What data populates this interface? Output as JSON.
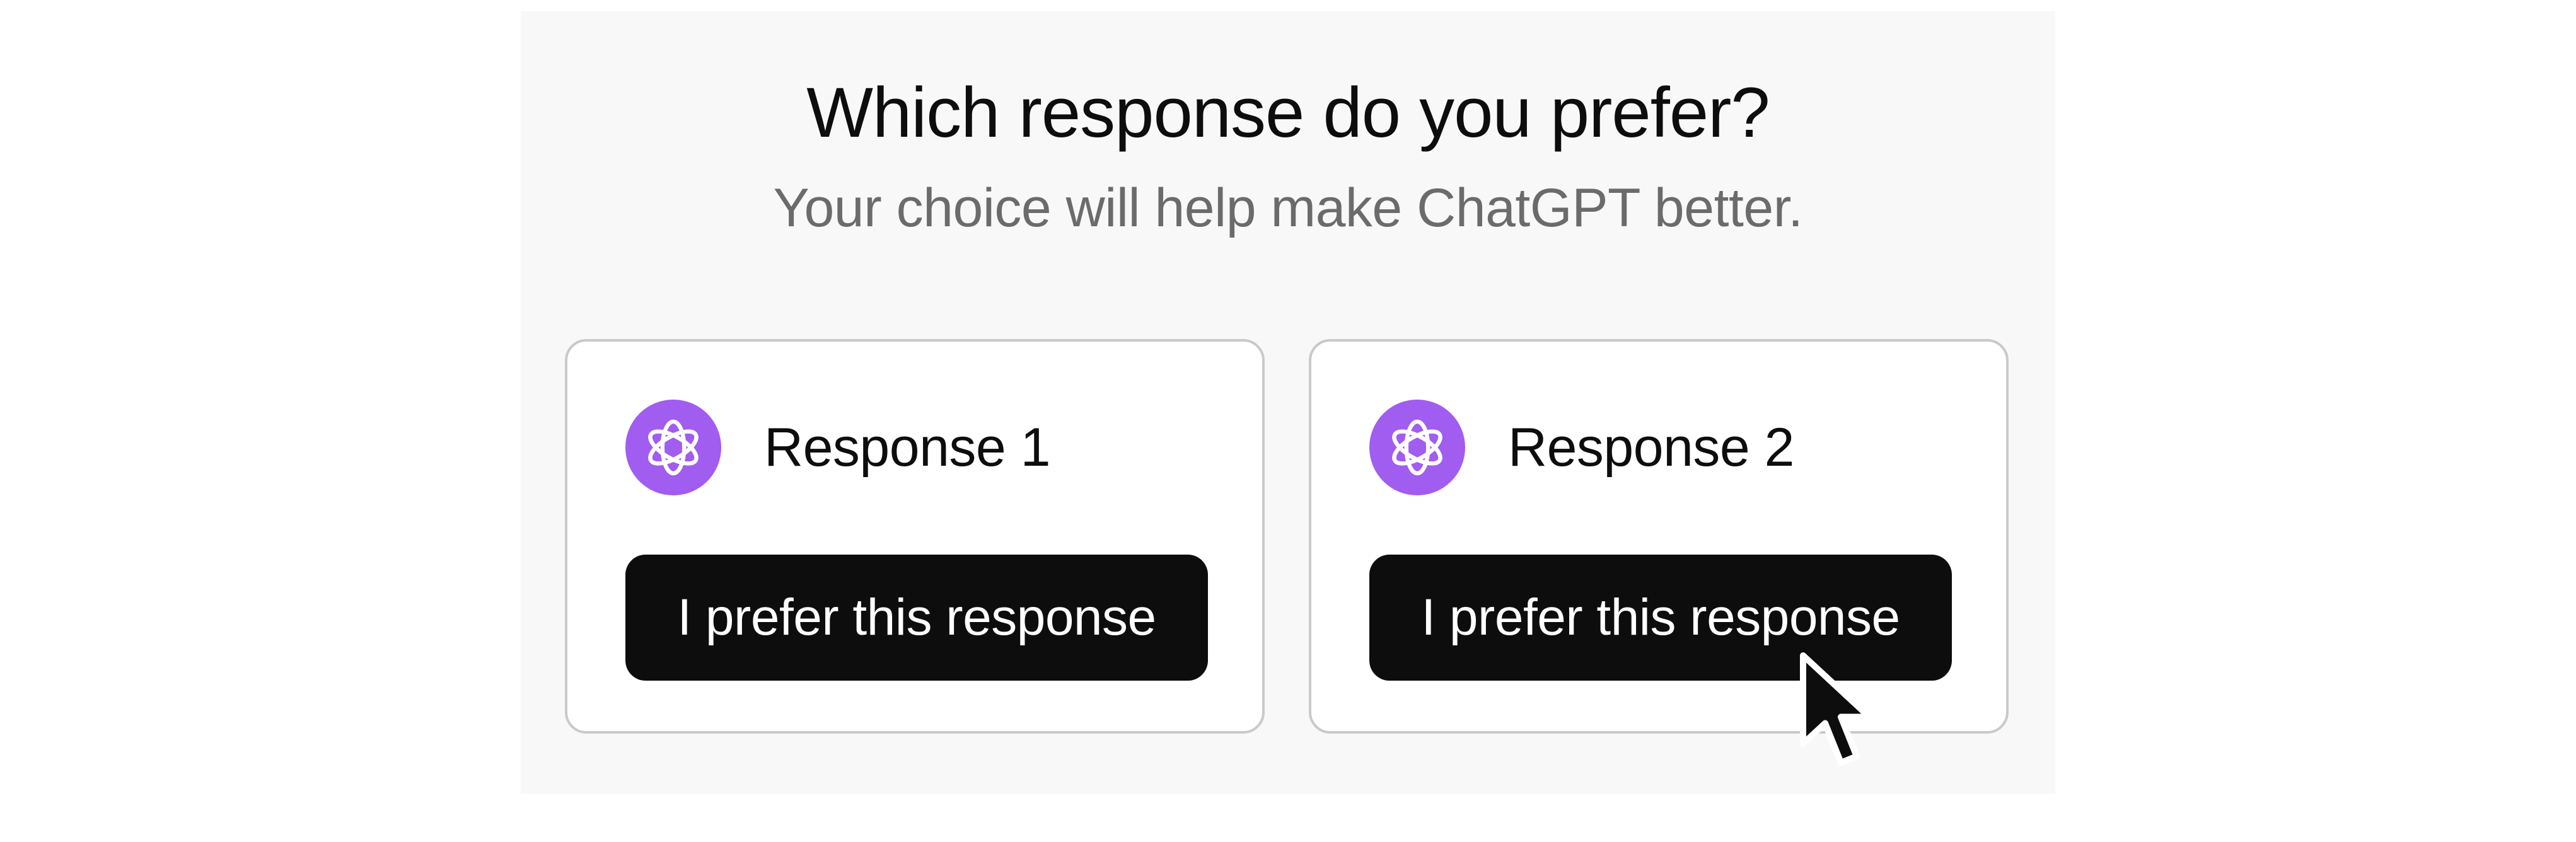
{
  "dialog": {
    "title": "Which response do you prefer?",
    "subtitle": "Your choice will help make ChatGPT better."
  },
  "responses": [
    {
      "label": "Response 1",
      "button_label": "I prefer this response",
      "avatar_icon": "openai-logo-icon"
    },
    {
      "label": "Response 2",
      "button_label": "I prefer this response",
      "avatar_icon": "openai-logo-icon"
    }
  ],
  "pointer": {
    "icon": "arrow-cursor-icon"
  },
  "colors": {
    "avatar_bg": "#a15cf0",
    "button_bg": "#0d0d0d",
    "button_text": "#ffffff",
    "title_text": "#0d0d0d",
    "subtitle_text": "#6b6b6b",
    "card_border": "#c9c9c9"
  }
}
